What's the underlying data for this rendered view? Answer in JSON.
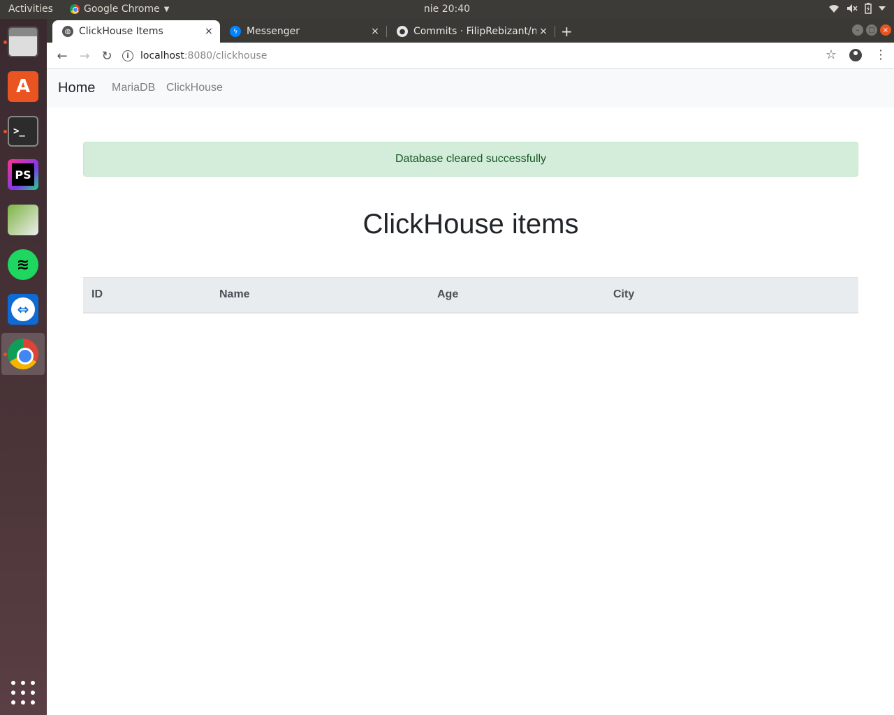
{
  "system": {
    "activities": "Activities",
    "app_name": "Google Chrome",
    "clock": "nie 20:40"
  },
  "tabs": [
    {
      "title": "ClickHouse Items",
      "close": "×"
    },
    {
      "title": "Messenger",
      "close": "×"
    },
    {
      "title": "Commits · FilipRebizant/n",
      "close": "×"
    }
  ],
  "toolbar": {
    "url_host": "localhost",
    "url_path": ":8080/clickhouse"
  },
  "navbar": {
    "brand": "Home",
    "links": [
      "MariaDB",
      "ClickHouse"
    ]
  },
  "alert": {
    "message": "Database cleared successfully"
  },
  "main": {
    "heading": "ClickHouse items"
  },
  "table": {
    "columns": [
      "ID",
      "Name",
      "Age",
      "City"
    ],
    "rows": []
  },
  "colors": {
    "alert_bg": "#d4edda",
    "alert_text": "#155724",
    "navbar_bg": "#f8f9fa",
    "table_header_bg": "#e9ecef",
    "ubuntu_orange": "#e95420"
  }
}
